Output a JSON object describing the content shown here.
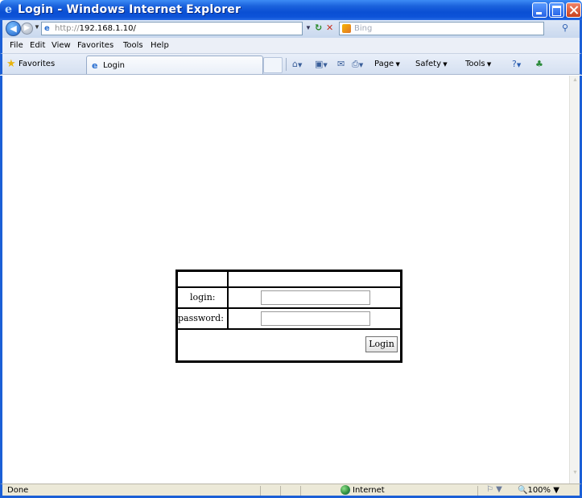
{
  "window": {
    "title": "Login - Windows Internet Explorer"
  },
  "address_bar": {
    "scheme": "http://",
    "host": "192.168.1.10/"
  },
  "search": {
    "placeholder": "Bing"
  },
  "menu": {
    "items": [
      "File",
      "Edit",
      "View",
      "Favorites",
      "Tools",
      "Help"
    ]
  },
  "favorites_bar": {
    "favorites_label": "Favorites",
    "tab_label": "Login"
  },
  "command_bar": {
    "page_label": "Page",
    "safety_label": "Safety",
    "tools_label": "Tools"
  },
  "login_form": {
    "login_label": "login:",
    "password_label": "password:",
    "login_value": "",
    "password_value": "",
    "button_label": "Login"
  },
  "status_bar": {
    "status_text": "Done",
    "zone_text": "Internet",
    "zoom_text": "100%"
  },
  "colors": {
    "titlebar": "#0a4fd4",
    "frame": "#1b5fd6",
    "statusbar": "#ece9d8"
  }
}
